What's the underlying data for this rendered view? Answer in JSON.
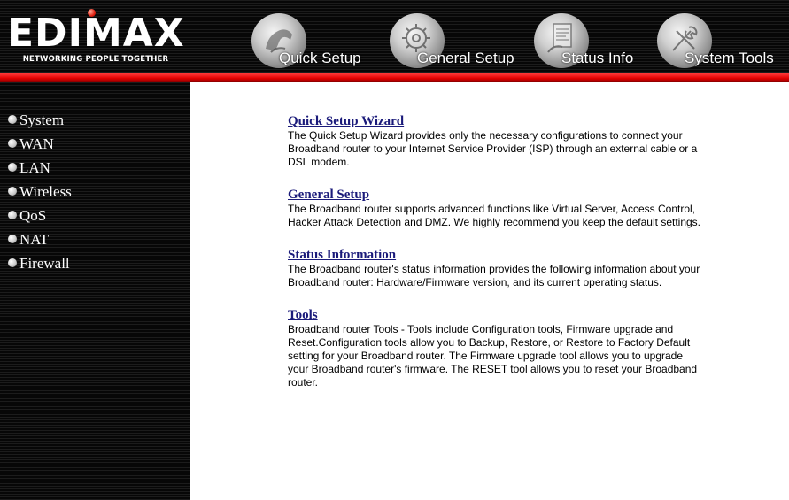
{
  "brand": {
    "logo_text": "EDIMAX",
    "tagline": "NETWORKING PEOPLE TOGETHER"
  },
  "nav": [
    {
      "label": "Quick Setup",
      "icon": "hand-icon"
    },
    {
      "label": "General Setup",
      "icon": "gear-icon"
    },
    {
      "label": "Status Info",
      "icon": "document-icon"
    },
    {
      "label": "System Tools",
      "icon": "tools-icon"
    }
  ],
  "sidebar": {
    "items": [
      {
        "label": "System"
      },
      {
        "label": "WAN"
      },
      {
        "label": "LAN"
      },
      {
        "label": "Wireless"
      },
      {
        "label": "QoS"
      },
      {
        "label": "NAT"
      },
      {
        "label": "Firewall"
      }
    ]
  },
  "sections": [
    {
      "title": "Quick Setup Wizard",
      "text": "The Quick Setup Wizard provides only the necessary configurations to connect your Broadband router to your Internet Service Provider (ISP) through an external cable or a DSL modem."
    },
    {
      "title": "General Setup",
      "text": "The Broadband router supports advanced functions like Virtual Server, Access Control, Hacker Attack Detection and DMZ. We highly recommend you keep the default settings."
    },
    {
      "title": "Status Information",
      "text": "The Broadband router's status information provides the following information about your Broadband router: Hardware/Firmware version, and its current operating status."
    },
    {
      "title": "Tools",
      "text": "Broadband router Tools - Tools include Configuration tools, Firmware upgrade and Reset.Configuration tools allow you to Backup, Restore, or Restore to Factory Default setting for your Broadband router. The Firmware upgrade tool allows you to upgrade your Broadband router's firmware. The RESET tool allows you to reset your Broadband router."
    }
  ],
  "colors": {
    "accent_red": "#e00000",
    "link_blue": "#1a1a7a",
    "sidebar_bg": "#0b0b0b"
  }
}
